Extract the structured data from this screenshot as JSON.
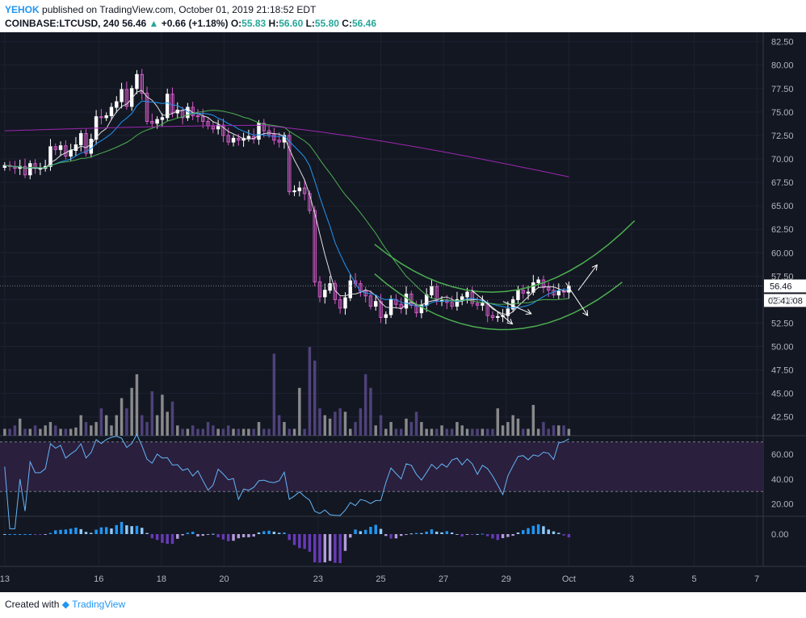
{
  "header": {
    "user": "YEHOK",
    "published": "published on TradingView.com, October 01, 2019 21:18:52 EDT",
    "symbol": "COINBASE:LTCUSD, 240",
    "last": "56.46",
    "change_arrow": "▲",
    "change": "+0.66 (+1.18%)",
    "o_label": "O:",
    "o_value": "55.83",
    "h_label": "H:",
    "h_value": "56.60",
    "l_label": "L:",
    "l_value": "55.80",
    "c_label": "C:",
    "c_value": "56.46"
  },
  "footer": {
    "created_with": "Created with",
    "brand": "TradingView"
  },
  "chart_data": {
    "type": "candlestick",
    "symbol": "COINBASE:LTCUSD",
    "interval": "240",
    "price_axis": {
      "range": [
        40.5,
        83.5
      ],
      "ticks": [
        "82.50",
        "80.00",
        "77.50",
        "75.00",
        "72.50",
        "70.00",
        "67.50",
        "65.00",
        "62.50",
        "60.00",
        "57.50",
        "55.00",
        "52.50",
        "50.00",
        "47.50",
        "45.00",
        "42.50"
      ],
      "last_price_label": "56.46",
      "countdown_label": "02:41:08"
    },
    "x_axis": {
      "ticks": [
        {
          "label": "13",
          "x": 0
        },
        {
          "label": "16",
          "x": 3
        },
        {
          "label": "18",
          "x": 5
        },
        {
          "label": "20",
          "x": 7
        },
        {
          "label": "23",
          "x": 10
        },
        {
          "label": "25",
          "x": 12
        },
        {
          "label": "27",
          "x": 14
        },
        {
          "label": "29",
          "x": 16
        },
        {
          "label": "Oct",
          "x": 18
        },
        {
          "label": "3",
          "x": 20
        },
        {
          "label": "5",
          "x": 22
        },
        {
          "label": "7",
          "x": 24
        }
      ],
      "range": [
        -0.15,
        24.2
      ]
    },
    "closes": [
      69.3,
      69.2,
      69.0,
      69.2,
      68.3,
      69.5,
      69.0,
      69.0,
      69.2,
      71.3,
      71.0,
      71.4,
      70.3,
      70.9,
      71.5,
      72.7,
      70.6,
      72.1,
      74.5,
      74.4,
      74.6,
      75.5,
      76.1,
      77.4,
      75.6,
      77.5,
      79.0,
      77.0,
      74.0,
      73.8,
      74.2,
      74.4,
      76.9,
      74.9,
      75.2,
      74.4,
      75.5,
      74.6,
      74.5,
      74.0,
      73.5,
      73.2,
      73.6,
      72.5,
      71.8,
      72.2,
      72.0,
      72.2,
      72.4,
      72.1,
      73.8,
      73.0,
      72.6,
      72.0,
      71.8,
      72.5,
      66.5,
      66.6,
      66.9,
      66.3,
      64.5,
      56.9,
      55.3,
      56.0,
      56.7,
      55.0,
      54.1,
      55.2,
      57.0,
      56.7,
      55.9,
      55.4,
      54.3,
      54.8,
      53.1,
      53.4,
      55.0,
      54.5,
      54.1,
      55.6,
      54.4,
      53.6,
      54.4,
      55.5,
      56.4,
      54.9,
      54.9,
      54.7,
      54.3,
      55.0,
      55.3,
      55.8,
      54.6,
      54.4,
      54.6,
      53.3,
      53.1,
      53.2,
      53.3,
      54.0,
      55.0,
      56.0,
      55.7,
      55.8,
      56.8,
      57.1,
      56.3,
      56.0,
      55.5,
      55.9,
      55.8,
      56.46
    ],
    "volume_scale_max": 13,
    "volumes": [
      1,
      1,
      1.5,
      2.5,
      1,
      1,
      1.5,
      1,
      1.5,
      2,
      1.5,
      1,
      1,
      1,
      1.2,
      3,
      2,
      1.5,
      2,
      4,
      3,
      1.5,
      3,
      5.5,
      4,
      7,
      9,
      3,
      2,
      6.5,
      3,
      6,
      3.5,
      5,
      1.5,
      1,
      1,
      1.5,
      1,
      1,
      2,
      1.5,
      1,
      1,
      1.5,
      1,
      1,
      1,
      1,
      1,
      2,
      1,
      1,
      12,
      3,
      2,
      1,
      1,
      7,
      1,
      13,
      11,
      4,
      3,
      2.5,
      3.5,
      4,
      3.5,
      1,
      2,
      4,
      9,
      7,
      1.5,
      3,
      1,
      2,
      1,
      1,
      2.5,
      2,
      3.5,
      2,
      1,
      1,
      1,
      1.5,
      1,
      1,
      2,
      1.5,
      1,
      1,
      1,
      1,
      1,
      1,
      4,
      1.5,
      2,
      3,
      2.5,
      1,
      1,
      4.5,
      1,
      2,
      1,
      1.5,
      1.5,
      1.5,
      1
    ],
    "rsi": {
      "levels": [
        70,
        30
      ],
      "ticks": [
        "60.00",
        "40.00",
        "20.00"
      ],
      "range": [
        10,
        75
      ]
    },
    "histogram": {
      "tick": "0.00",
      "range": [
        -2.0,
        1.1
      ]
    },
    "annotations": {
      "trend_arcs": "green curved channel drawn below and above the base",
      "arrows": "white projected swing arrows"
    },
    "colors": {
      "background": "#131722",
      "grid": "#1e2230",
      "up_candle": "#ffffff",
      "down_candle": "#d35ac7",
      "volume_up": "#9e9e9e",
      "volume_down": "#5b4a8a",
      "ma_fast": "#e0e0e0",
      "ma_mid": "#2196f3",
      "ma_slow": "#4caf50",
      "ma_long": "#9c27b0",
      "rsi_line": "#64b5f6",
      "rsi_band": "#2a1f3d",
      "hist_pos": "#2196f3",
      "hist_pos_light": "#90caf9",
      "hist_neg": "#673ab7",
      "hist_neg_light": "#b39ddb",
      "channel": "#4caf50",
      "text": "#b2b5be",
      "brand": "#2196f3"
    }
  }
}
